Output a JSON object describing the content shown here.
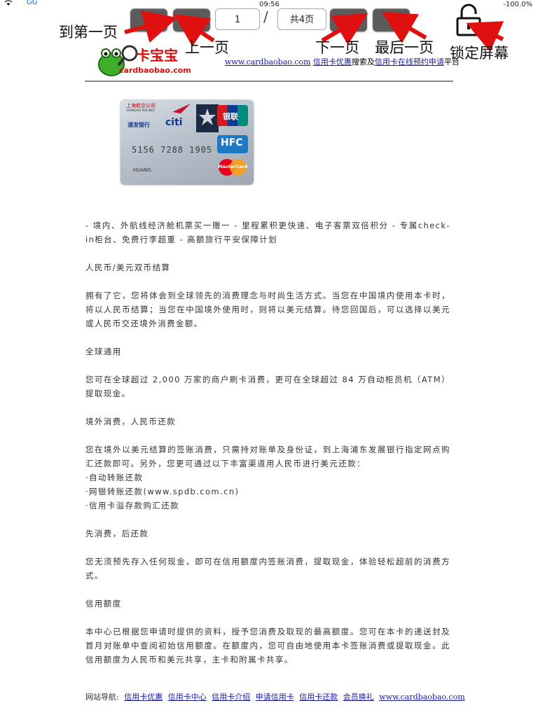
{
  "status_bar": {
    "carrier": "GG",
    "time": "09:56",
    "battery": "-100.0%"
  },
  "toolbar": {
    "first_symbol": "«",
    "prev_symbol": "‹",
    "next_symbol": "›",
    "last_symbol": "»",
    "page_value": "1",
    "separator": "/",
    "total_pages": "共4页"
  },
  "annotations": {
    "first": "到第一页",
    "prev": "上一页",
    "next": "下一页",
    "last": "最后一页",
    "lock": "锁定屏幕",
    "arrow_color": "#e01010"
  },
  "header": {
    "logo_text": "卡宝宝",
    "logo_url": "cardbaobao.com",
    "site_link": "www.cardbaobao.com",
    "promo_link": "信用卡优惠",
    "text_mid": "搜索及",
    "apply_link": "信用卡在线预约申请",
    "text_end": "平台"
  },
  "card": {
    "bank_cn": "上海航空公司",
    "airline_en": "SHANGHAI AIRLINES",
    "spdb": "浦发银行",
    "citi": "citi",
    "unionpay": "银联",
    "number": "5156 7288 1905",
    "holder": "HUANG",
    "hfc": "HFC",
    "mastercard": "MasterCard"
  },
  "content": [
    "- 境内、外航线经济舱机票买一赠一  -  里程累积更快速、电子客票双倍积分  -  专属check-in柜台、免费行李超重  -  高额旅行平安保障计划",
    "人民币/美元双币结算",
    "拥有了它，您将体会到全球领先的消费理念与时尚生活方式。当您在中国境内使用本卡时，将以人民币结算；当您在中国境外使用时，则将以美元结算。待您回国后，可以选择以美元或人民币交还境外消费金额。",
    "全球通用",
    "您可在全球超过 2,000 万家的商户刷卡消费，更可在全球超过 84 万自动柜员机（ATM）提取现金。",
    "境外消费，人民币还款",
    "您在境外以美元结算的签账消费，只需持对账单及身份证，到上海浦东发展银行指定网点购汇还款即可。另外，您更可通过以下丰富渠道用人民币进行美元还款：",
    "·自动转账还款",
    "·网银转账还款(www.spdb.com.cn)",
    "·信用卡溢存款购汇还款",
    "先消费，后还款",
    "您无须预先存入任何现金，即可在信用额度内签账消费，提取现金，体验轻松超前的消费方式。",
    "信用额度",
    "本中心已根据您申请时提供的资料，授予您消费及取现的最高额度。您可在本卡的递送封及首月对账单中查阅初始信用额度。在额度内，您可自由地使用本卡签账消费或提取现金。此信用额度为人民币和美元共享，主卡和附属卡共享。"
  ],
  "footer": {
    "label": "网站导航:",
    "links": [
      "信用卡优惠",
      "信用卡中心",
      "信用卡介绍",
      "申请信用卡",
      "信用卡还款",
      "会员换礼",
      "www.cardbaobao.com"
    ]
  }
}
